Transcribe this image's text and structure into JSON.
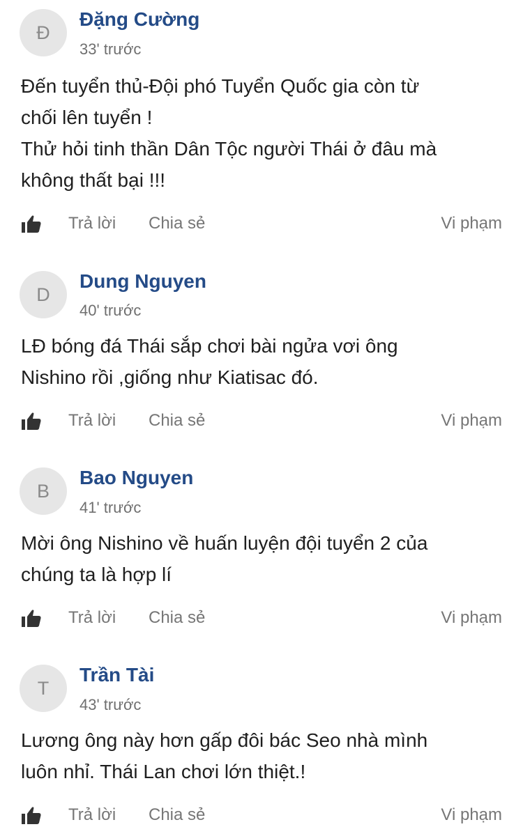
{
  "comments": [
    {
      "initial": "Đ",
      "author": "Đặng Cường",
      "time": "33' trước",
      "lines": [
        "Đến tuyển thủ-Đội phó Tuyển Quốc gia còn từ",
        "chối lên tuyển !",
        "Thử hỏi tinh thần Dân Tộc người Thái ở đâu mà",
        "không thất bại !!!"
      ]
    },
    {
      "initial": "D",
      "author": "Dung Nguyen",
      "time": "40' trước",
      "lines": [
        "LĐ bóng đá Thái sắp chơi bài ngửa vơi ông",
        "Nishino rồi ,giống như Kiatisac đó."
      ]
    },
    {
      "initial": "B",
      "author": "Bao Nguyen",
      "time": "41' trước",
      "lines": [
        "Mời ông Nishino về huấn luyện đội tuyển 2 của",
        "chúng ta là hợp lí"
      ]
    },
    {
      "initial": "T",
      "author": "Trần Tài",
      "time": "43' trước",
      "lines": [
        "Lương ông này hơn gấp đôi bác Seo nhà mình",
        "luôn nhỉ. Thái Lan chơi lớn thiệt.!"
      ]
    }
  ],
  "actions": {
    "like_icon": "thumbs-up-icon",
    "reply_label": "Trả lời",
    "share_label": "Chia sẻ",
    "report_label": "Vi phạm"
  },
  "colors": {
    "author": "#244b87",
    "time": "#6f6f6f",
    "action": "#767676",
    "avatar_bg": "#e6e6e6"
  }
}
